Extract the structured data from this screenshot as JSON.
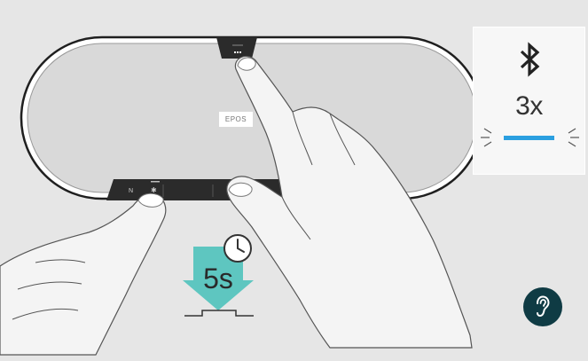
{
  "device": {
    "brand_label": "EPOS",
    "top_button_glyph": "...",
    "body_color": "#d9d9d9",
    "frame_color": "#1f1f1f",
    "control_strip_color": "#2b2b2b"
  },
  "bluetooth_indicator": {
    "icon": "bluetooth-icon",
    "press_count": "3x",
    "led_color": "#2b9fe0",
    "led_state": "flashing"
  },
  "press_instruction": {
    "duration": "5s",
    "arrow_color": "#5ec6c0",
    "icon": "clock-icon"
  },
  "help": {
    "icon": "ear-question-icon",
    "color": "#0f3b44"
  },
  "colors": {
    "background": "#e6e6e6",
    "hand_outline": "#555555",
    "hand_fill": "#f4f4f4"
  }
}
